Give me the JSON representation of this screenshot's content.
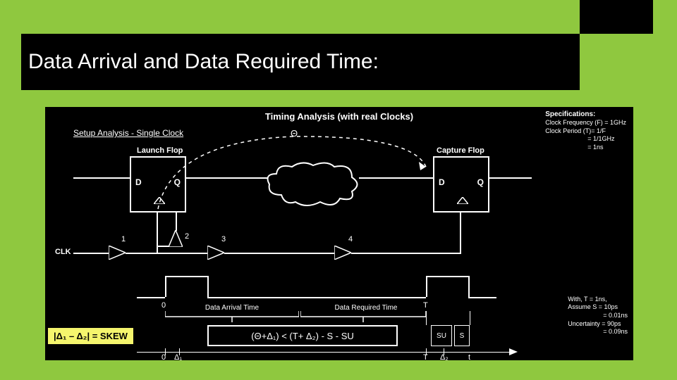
{
  "slide": {
    "title": "Data Arrival and Data Required Time:"
  },
  "diagram": {
    "main_title": "Timing Analysis (with real Clocks)",
    "subtitle": "Setup Analysis - Single Clock",
    "launch_label": "Launch Flop",
    "capture_label": "Capture Flop",
    "flop_d": "D",
    "flop_q": "Q",
    "theta": "Θ",
    "clk": "CLK",
    "buf1": "1",
    "buf2": "2",
    "buf3": "3",
    "buf4": "4",
    "zero": "0",
    "T": "T",
    "arrival_label": "Data Arrival Time",
    "required_label": "Data Required Time",
    "formula": "(Θ+Δ₁) < (T+ Δ₂) - S - SU",
    "SU": "SU",
    "S": "S",
    "skew": "|Δ₁ – Δ₂| = SKEW",
    "axis_0": "0",
    "axis_d1": "Δ₁",
    "axis_T": "T",
    "axis_d2": "Δ₂",
    "axis_t": "t"
  },
  "specs1": {
    "head": "Specifications:",
    "l1": "Clock Frequency (F) = 1GHz",
    "l2": "Clock Period (T)= 1/F",
    "l3": "= 1/1GHz",
    "l4": "= 1ns"
  },
  "specs2": {
    "l1": "With, T = 1ns,",
    "l2": "Assume S = 10ps",
    "l3": "= 0.01ns",
    "l4": "Uncertainty = 90ps",
    "l5": "= 0.09ns"
  }
}
